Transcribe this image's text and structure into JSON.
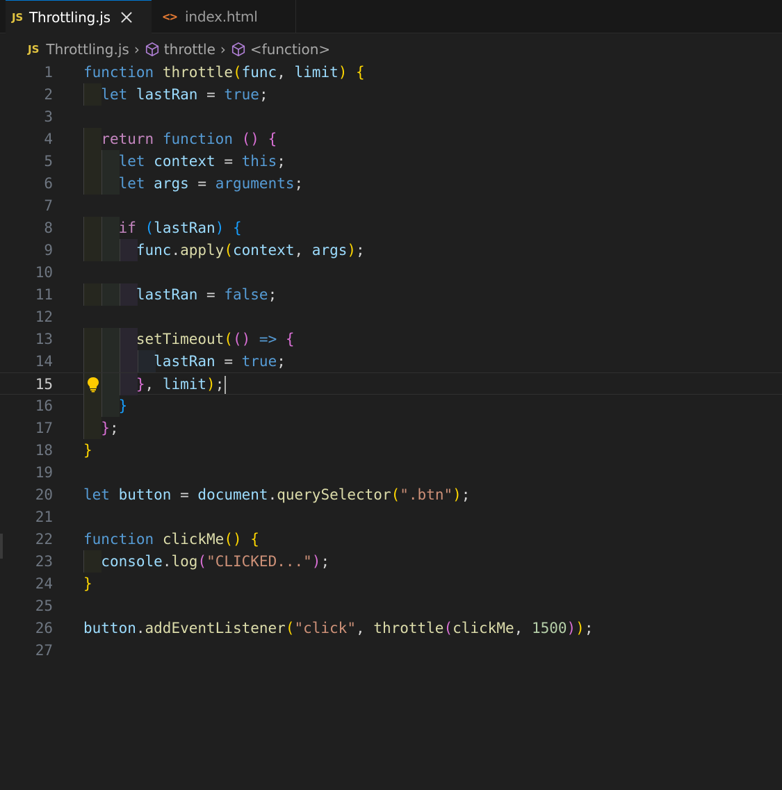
{
  "tabs": [
    {
      "glyph": "JS",
      "label": "Throttling.js",
      "active": true
    },
    {
      "glyph": "<>",
      "label": "index.html",
      "active": false
    }
  ],
  "breadcrumb": {
    "file_glyph": "JS",
    "file": "Throttling.js",
    "symbol1": "throttle",
    "symbol2": "<function>"
  },
  "editor": {
    "current_line": "15",
    "line_numbers": [
      "1",
      "2",
      "3",
      "4",
      "5",
      "6",
      "7",
      "8",
      "9",
      "10",
      "11",
      "12",
      "13",
      "14",
      "15",
      "16",
      "17",
      "18",
      "19",
      "20",
      "21",
      "22",
      "23",
      "24",
      "25",
      "26",
      "27"
    ],
    "lines": [
      "function throttle(func, limit) {",
      "  let lastRan = true;",
      "",
      "  return function () {",
      "    let context = this;",
      "    let args = arguments;",
      "",
      "    if (lastRan) {",
      "      func.apply(context, args);",
      "",
      "      lastRan = false;",
      "",
      "      setTimeout(() => {",
      "        lastRan = true;",
      "      }, limit);",
      "    }",
      "  };",
      "}",
      "",
      "let button = document.querySelector(\".btn\");",
      "",
      "function clickMe() {",
      "  console.log(\"CLICKED...\");",
      "}",
      "",
      "button.addEventListener(\"click\", throttle(clickMe, 1500));",
      ""
    ]
  },
  "icons": {
    "lightbulb": "lightbulb-icon",
    "close": "close-icon",
    "symbol": "cube-icon"
  },
  "colors": {
    "background": "#1f1f1f",
    "keyword": "#569cd6",
    "control": "#c586c0",
    "function": "#dcdcaa",
    "variable": "#9cdcfe",
    "string": "#ce9178",
    "number": "#b5cea8",
    "js_badge": "#e2c440",
    "html_badge": "#e37933"
  }
}
